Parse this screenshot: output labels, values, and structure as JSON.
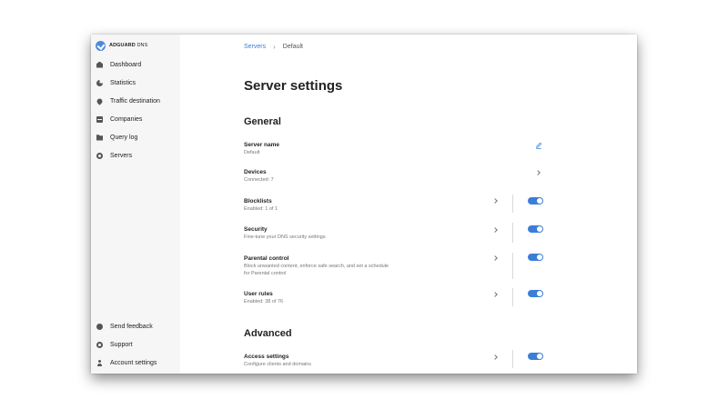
{
  "brand": {
    "name_bold": "ADGUARD",
    "name_rest": " DNS"
  },
  "sidebar": {
    "items": [
      {
        "label": "Dashboard",
        "icon": "house-icon"
      },
      {
        "label": "Statistics",
        "icon": "pie-chart-icon"
      },
      {
        "label": "Traffic destination",
        "icon": "location-pin-icon"
      },
      {
        "label": "Companies",
        "icon": "company-icon"
      },
      {
        "label": "Query log",
        "icon": "folder-icon"
      },
      {
        "label": "Servers",
        "icon": "gear-icon"
      }
    ],
    "bottom_items": [
      {
        "label": "Send feedback",
        "icon": "chat-bubble-icon"
      },
      {
        "label": "Support",
        "icon": "support-icon"
      },
      {
        "label": "Account settings",
        "icon": "account-icon"
      }
    ]
  },
  "breadcrumb": {
    "link": "Servers",
    "current": "Default"
  },
  "page": {
    "title": "Server settings"
  },
  "sections": {
    "general": "General",
    "advanced": "Advanced"
  },
  "settings": {
    "server_name": {
      "title": "Server name",
      "sub": "Default"
    },
    "devices": {
      "title": "Devices",
      "sub": "Connected: 7"
    },
    "blocklists": {
      "title": "Blocklists",
      "sub": "Enabled: 1 of 1",
      "enabled": true
    },
    "security": {
      "title": "Security",
      "sub": "Fine-tune your DNS security settings",
      "enabled": true
    },
    "parental": {
      "title": "Parental control",
      "sub": "Block unwanted content, enforce safe search, and set a schedule for Parental control",
      "enabled": true
    },
    "user_rules": {
      "title": "User rules",
      "sub": "Enabled: 38 of 76",
      "enabled": true
    },
    "access": {
      "title": "Access settings",
      "sub": "Configure clients and domains",
      "enabled": true
    }
  },
  "colors": {
    "accent": "#3b7ed8",
    "sidebar_bg": "#f6f6f6"
  }
}
